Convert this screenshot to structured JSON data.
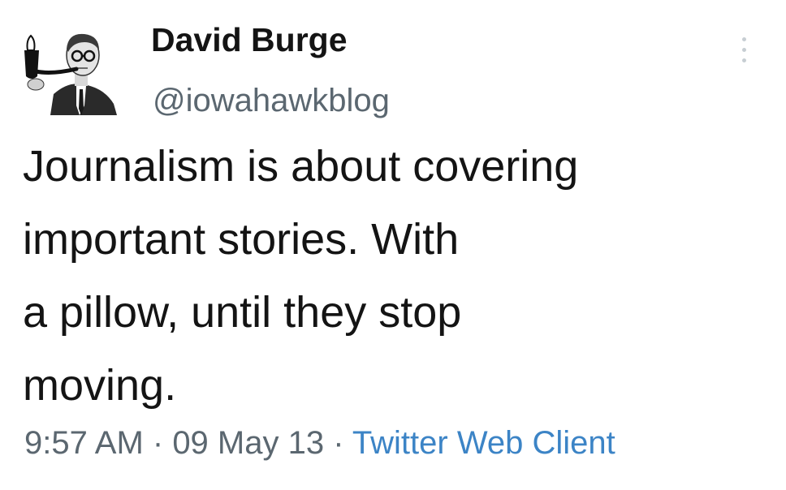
{
  "author": {
    "name": "David Burge",
    "handle": "@iowahawkblog"
  },
  "icons": {
    "avatar": "person-with-pipe-avatar",
    "more": "more-options-icon"
  },
  "tweet": {
    "lines": [
      "Journalism is about covering",
      "important stories. With",
      "a pillow, until they stop",
      "moving."
    ]
  },
  "meta": {
    "time": "9:57 AM",
    "separator": " · ",
    "date": "09 May 13",
    "source": "Twitter Web Client"
  },
  "colors": {
    "text": "#141414",
    "secondary": "#5b6770",
    "link": "#3c84c6"
  }
}
